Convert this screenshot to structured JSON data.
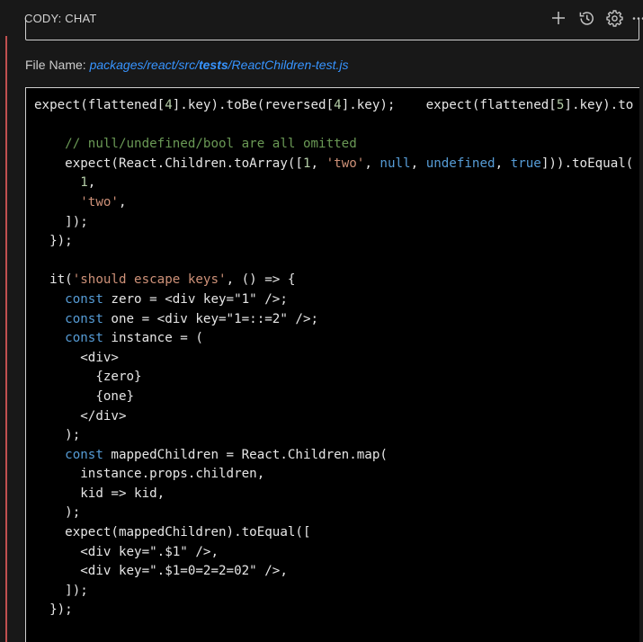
{
  "header": {
    "title": "CODY: CHAT",
    "icons": [
      "plus-icon",
      "history-icon",
      "gear-icon",
      "more-icon"
    ]
  },
  "file": {
    "label": "File Name: ",
    "path_prefix": "packages/react/src/",
    "path_bold": "tests",
    "path_suffix": "/ReactChildren-test.js"
  },
  "colors": {
    "keyword": "#569cd6",
    "string": "#ce9178",
    "number": "#b5cea8",
    "comment": "#6a9955",
    "link": "#3794ff",
    "accent_bar": "#c05050"
  },
  "code_lines": [
    [
      [
        "expect(flattened[",
        "t"
      ],
      [
        "4",
        "n"
      ],
      [
        "].key).toBe(reversed[",
        "t"
      ],
      [
        "4",
        "n"
      ],
      [
        "].key);    expect(flattened[",
        "t"
      ],
      [
        "5",
        "n"
      ],
      [
        "].key).to",
        "t"
      ]
    ],
    [],
    [
      [
        "    ",
        "t"
      ],
      [
        "// null/undefined/bool are all omitted",
        "c"
      ]
    ],
    [
      [
        "    expect(React.Children.toArray([",
        "t"
      ],
      [
        "1",
        "n"
      ],
      [
        ", ",
        "t"
      ],
      [
        "'two'",
        "s"
      ],
      [
        ", ",
        "t"
      ],
      [
        "null",
        "k"
      ],
      [
        ", ",
        "t"
      ],
      [
        "undefined",
        "k"
      ],
      [
        ", ",
        "t"
      ],
      [
        "true",
        "k"
      ],
      [
        "])).toEqual(",
        "t"
      ]
    ],
    [
      [
        "      ",
        "t"
      ],
      [
        "1",
        "n"
      ],
      [
        ",",
        "t"
      ]
    ],
    [
      [
        "      ",
        "t"
      ],
      [
        "'two'",
        "s"
      ],
      [
        ",",
        "t"
      ]
    ],
    [
      [
        "    ]);",
        "t"
      ]
    ],
    [
      [
        "  });",
        "t"
      ]
    ],
    [],
    [
      [
        "  it(",
        "t"
      ],
      [
        "'should escape keys'",
        "s"
      ],
      [
        ", () => {",
        "t"
      ]
    ],
    [
      [
        "    ",
        "t"
      ],
      [
        "const",
        "k"
      ],
      [
        " zero = <div key=\"1\" />;",
        "t"
      ]
    ],
    [
      [
        "    ",
        "t"
      ],
      [
        "const",
        "k"
      ],
      [
        " one = <div key=\"1=::=2\" />;",
        "t"
      ]
    ],
    [
      [
        "    ",
        "t"
      ],
      [
        "const",
        "k"
      ],
      [
        " instance = (",
        "t"
      ]
    ],
    [
      [
        "      <div>",
        "t"
      ]
    ],
    [
      [
        "        {zero}",
        "t"
      ]
    ],
    [
      [
        "        {one}",
        "t"
      ]
    ],
    [
      [
        "      </div>",
        "t"
      ]
    ],
    [
      [
        "    );",
        "t"
      ]
    ],
    [
      [
        "    ",
        "t"
      ],
      [
        "const",
        "k"
      ],
      [
        " mappedChildren = React.Children.map(",
        "t"
      ]
    ],
    [
      [
        "      instance.props.children,",
        "t"
      ]
    ],
    [
      [
        "      kid => kid,",
        "t"
      ]
    ],
    [
      [
        "    );",
        "t"
      ]
    ],
    [
      [
        "    expect(mappedChildren).toEqual([",
        "t"
      ]
    ],
    [
      [
        "      <div key=\".$1\" />,",
        "t"
      ]
    ],
    [
      [
        "      <div key=\".$1=0=2=2=02\" />,",
        "t"
      ]
    ],
    [
      [
        "    ]);",
        "t"
      ]
    ],
    [
      [
        "  });",
        "t"
      ]
    ]
  ]
}
